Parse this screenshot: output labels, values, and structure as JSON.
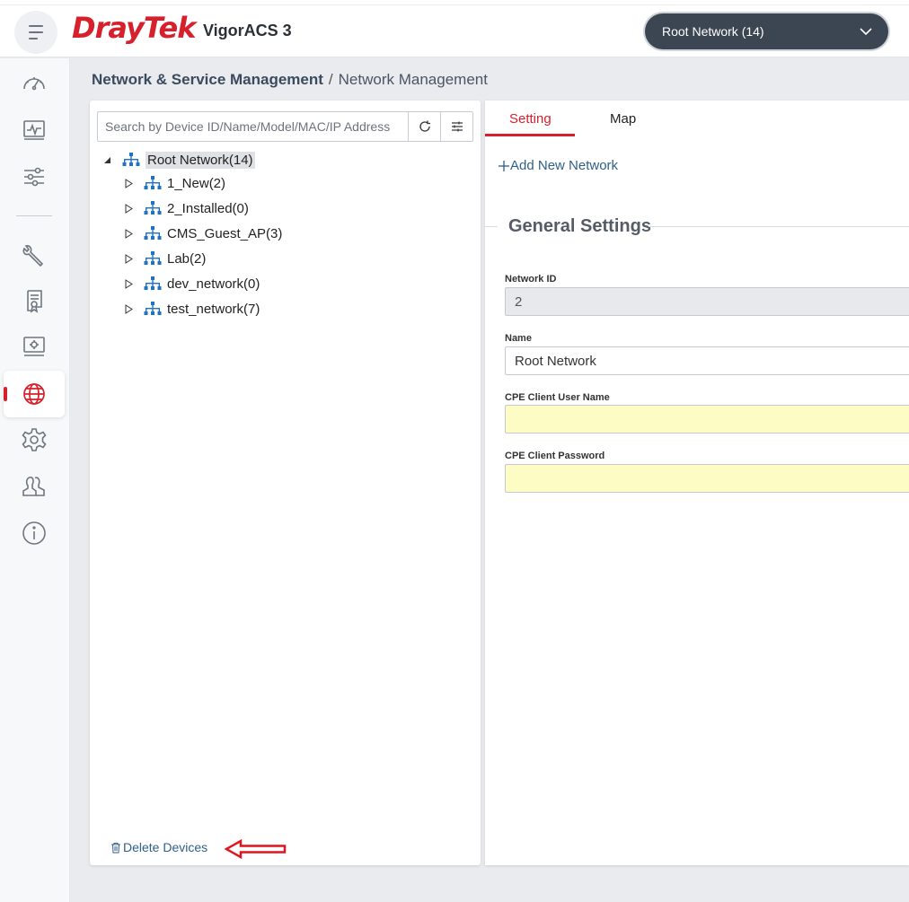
{
  "header": {
    "logo_text": "DrayTek",
    "product_name": "VigorACS 3",
    "network_selector": "Root Network (14)"
  },
  "sidebar": {
    "items": [
      {
        "icon": "dashboard-gauge-icon"
      },
      {
        "icon": "monitoring-icon"
      },
      {
        "icon": "filter-sliders-icon"
      },
      {
        "icon": "wrench-icon"
      },
      {
        "icon": "certificate-icon"
      },
      {
        "icon": "monitor-settings-icon"
      },
      {
        "icon": "globe-icon",
        "active": true
      },
      {
        "icon": "gear-icon"
      },
      {
        "icon": "users-icon"
      },
      {
        "icon": "info-icon"
      }
    ]
  },
  "breadcrumb": {
    "parent": "Network & Service Management",
    "separator": "/",
    "current": "Network Management"
  },
  "tree_panel": {
    "search_placeholder": "Search by Device ID/Name/Model/MAC/IP Address",
    "root": "Root Network(14)",
    "children": [
      "1_New(2)",
      "2_Installed(0)",
      "CMS_Guest_AP(3)",
      "Lab(2)",
      "dev_network(0)",
      "test_network(7)"
    ],
    "delete_label": "Delete Devices"
  },
  "settings_panel": {
    "tabs": [
      {
        "label": "Setting",
        "active": true
      },
      {
        "label": "Map",
        "active": false
      }
    ],
    "add_network_label": "Add New Network",
    "section_title": "General Settings",
    "fields": {
      "network_id": {
        "label": "Network ID",
        "value": "2"
      },
      "name": {
        "label": "Name",
        "value": "Root Network"
      },
      "cpe_user": {
        "label": "CPE Client User Name",
        "value": ""
      },
      "cpe_password": {
        "label": "CPE Client Password",
        "value": ""
      }
    }
  },
  "colors": {
    "brand_red": "#d6202c",
    "link_blue": "#2f5f8a",
    "selector_bg": "#3c4552",
    "tree_icon_blue": "#1e73c8",
    "highlight_yellow": "#fefcc5"
  }
}
